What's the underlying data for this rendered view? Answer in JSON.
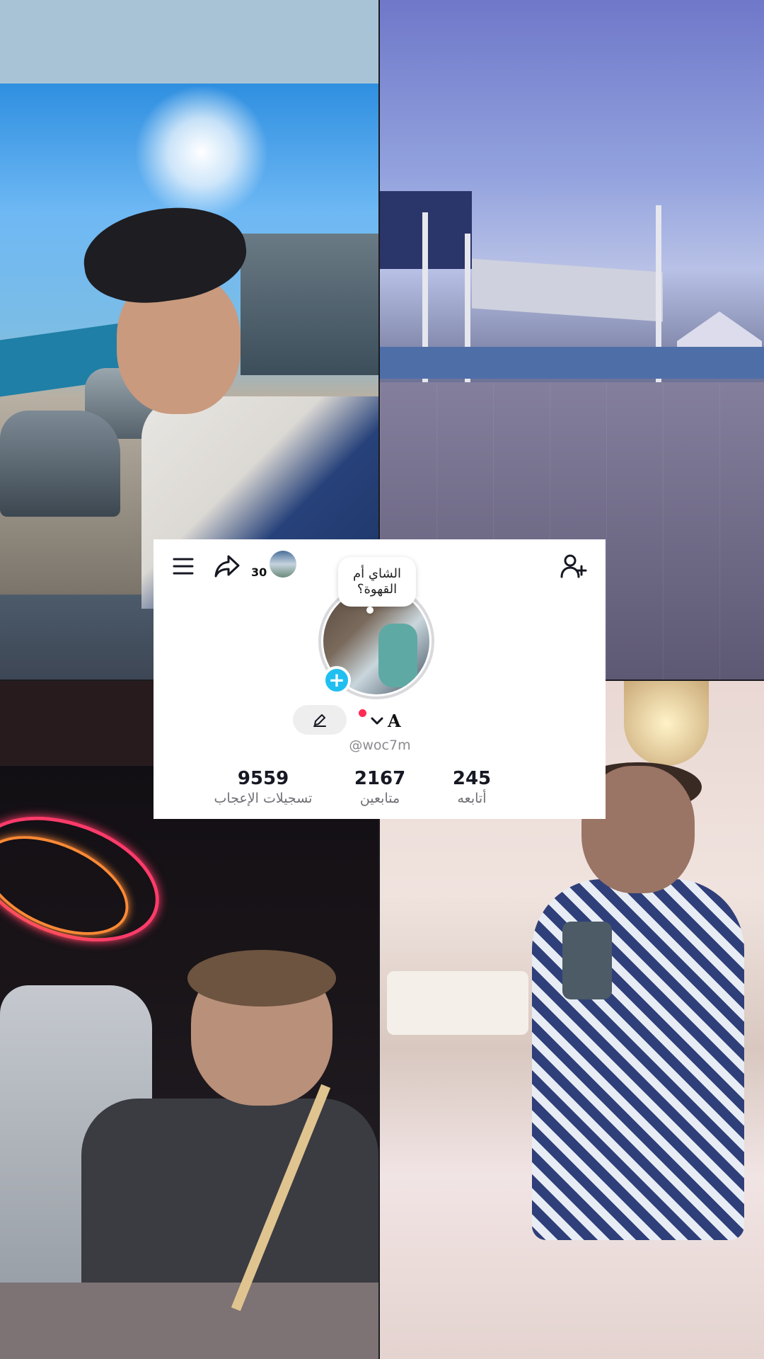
{
  "profile": {
    "story_count": "30",
    "note_text": "الشاي أم القهوة؟",
    "display_name": "A",
    "username": "@woc7m",
    "stats": {
      "likes": {
        "value": "9559",
        "label": "تسجيلات الإعجاب"
      },
      "followers": {
        "value": "2167",
        "label": "متابعين"
      },
      "following": {
        "value": "245",
        "label": "أتابعه"
      }
    }
  },
  "icons": {
    "menu": "menu-icon",
    "share": "share-icon",
    "add_user": "add-user-icon",
    "edit": "pencil-icon",
    "chevron": "chevron-down-icon",
    "plus": "plus-icon"
  },
  "colors": {
    "accent_blue": "#21bff0",
    "live_dot": "#ff2b55",
    "card_bg": "#ffffff"
  },
  "plus_symbol": "+"
}
